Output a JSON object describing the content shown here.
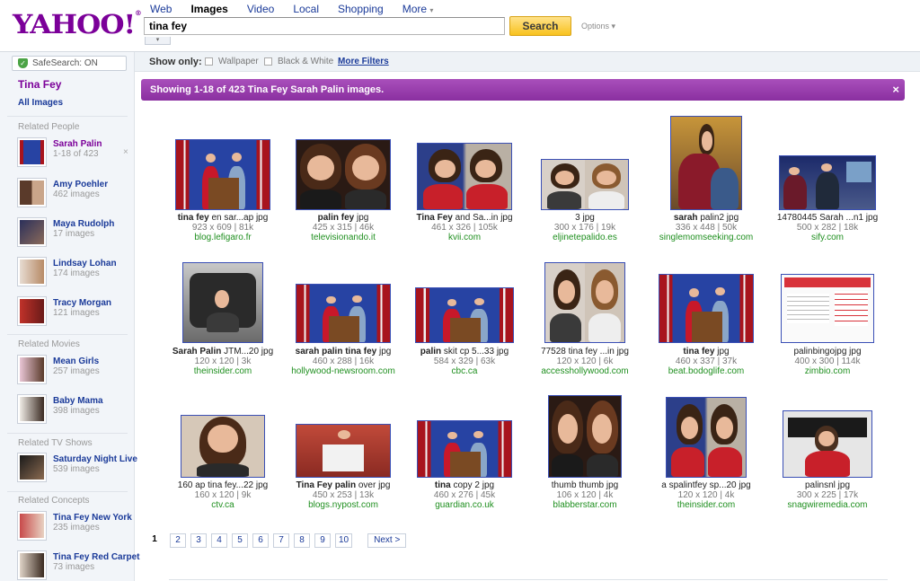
{
  "header": {
    "logo_text": "YAHOO!",
    "logo_mark": "®",
    "tabs": [
      "Web",
      "Images",
      "Video",
      "Local",
      "Shopping",
      "More"
    ],
    "search_value": "tina fey",
    "search_button": "Search",
    "options_label": "Options"
  },
  "filters": {
    "safesearch": "SafeSearch: ON",
    "show_only": "Show only:",
    "wallpaper": "Wallpaper",
    "bw": "Black & White",
    "more_filters": "More Filters"
  },
  "sidebar": {
    "query": "Tina Fey",
    "all_images": "All Images",
    "headings": {
      "people": "Related People",
      "movies": "Related Movies",
      "tv": "Related TV Shows",
      "concepts": "Related Concepts"
    },
    "people": [
      {
        "name": "Sarah Palin",
        "count": "1-18 of 423"
      },
      {
        "name": "Amy Poehler",
        "count": "462 images"
      },
      {
        "name": "Maya Rudolph",
        "count": "17 images"
      },
      {
        "name": "Lindsay Lohan",
        "count": "174 images"
      },
      {
        "name": "Tracy Morgan",
        "count": "121 images"
      }
    ],
    "movies": [
      {
        "name": "Mean Girls",
        "count": "257 images"
      },
      {
        "name": "Baby Mama",
        "count": "398 images"
      }
    ],
    "tv": [
      {
        "name": "Saturday Night Live",
        "count": "539 images"
      }
    ],
    "concepts": [
      {
        "name": "Tina Fey New York",
        "count": "235 images"
      },
      {
        "name": "Tina Fey Red Carpet",
        "count": "73 images"
      }
    ],
    "remove_icon": "×"
  },
  "banner": {
    "text": "Showing 1-18 of 423 Tina Fey Sarah Palin images.",
    "close": "×"
  },
  "results": [
    {
      "b": "tina fey",
      "r": " en sar...ap jpg",
      "meta": "923 x 609 | 81k",
      "src": "blog.lefigaro.fr"
    },
    {
      "b": "palin fey",
      "r": " jpg",
      "meta": "425 x 315 | 46k",
      "src": "televisionando.it"
    },
    {
      "b": "Tina Fey",
      "r": " and Sa...in jpg",
      "meta": "461 x 326 | 105k",
      "src": "kvii.com"
    },
    {
      "b": "",
      "r": "3 jpg",
      "meta": "300 x 176 | 19k",
      "src": "eljinetepalido.es"
    },
    {
      "b": "sarah",
      "r": " palin2 jpg",
      "meta": "336 x 448 | 50k",
      "src": "singlemomseeking.com"
    },
    {
      "b": "",
      "r": "14780445 Sarah ...n1 jpg",
      "meta": "500 x 282 | 18k",
      "src": "sify.com"
    },
    {
      "b": "Sarah Palin",
      "r": " JTM...20 jpg",
      "meta": "120 x 120 | 3k",
      "src": "theinsider.com"
    },
    {
      "b": "sarah palin tina fey",
      "r": " jpg",
      "meta": "460 x 288 | 16k",
      "src": "hollywood-newsroom.com"
    },
    {
      "b": "palin",
      "r": " skit cp 5...33 jpg",
      "meta": "584 x 329 | 63k",
      "src": "cbc.ca"
    },
    {
      "b": "",
      "r": "77528 tina fey ...in jpg",
      "meta": "120 x 120 | 6k",
      "src": "accesshollywood.com"
    },
    {
      "b": "tina fey",
      "r": " jpg",
      "meta": "460 x 337 | 37k",
      "src": "beat.bodoglife.com"
    },
    {
      "b": "",
      "r": "palinbingojpg jpg",
      "meta": "400 x 300 | 114k",
      "src": "zimbio.com"
    },
    {
      "b": "",
      "r": "160 ap tina fey...22 jpg",
      "meta": "160 x 120 | 9k",
      "src": "ctv.ca"
    },
    {
      "b": "Tina Fey palin",
      "r": " over jpg",
      "meta": "450 x 253 | 13k",
      "src": "blogs.nypost.com"
    },
    {
      "b": "tina",
      "r": " copy 2 jpg",
      "meta": "460 x 276 | 45k",
      "src": "guardian.co.uk"
    },
    {
      "b": "",
      "r": "thumb thumb jpg",
      "meta": "106 x 120 | 4k",
      "src": "blabberstar.com"
    },
    {
      "b": "",
      "r": "a spalintfey sp...20 jpg",
      "meta": "120 x 120 | 4k",
      "src": "theinsider.com"
    },
    {
      "b": "",
      "r": "palinsnl jpg",
      "meta": "300 x 225 | 17k",
      "src": "snagwiremedia.com"
    }
  ],
  "pagination": {
    "pages": [
      "1",
      "2",
      "3",
      "4",
      "5",
      "6",
      "7",
      "8",
      "9",
      "10"
    ],
    "next": "Next >"
  },
  "icons": {
    "more_caret": "▾",
    "options_caret": "▾",
    "assist_toggle": "▾",
    "shield": "✓"
  }
}
